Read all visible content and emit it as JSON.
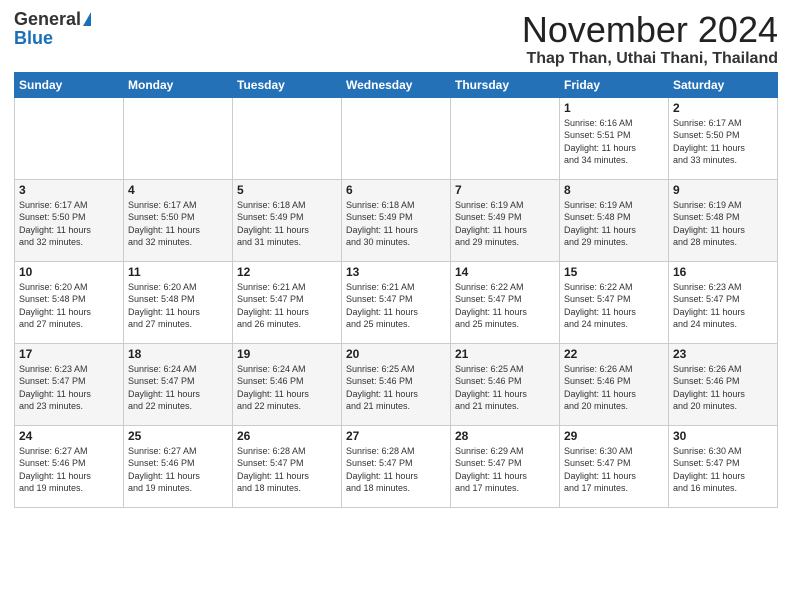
{
  "logo": {
    "general": "General",
    "blue": "Blue"
  },
  "title": {
    "month": "November 2024",
    "location": "Thap Than, Uthai Thani, Thailand"
  },
  "headers": [
    "Sunday",
    "Monday",
    "Tuesday",
    "Wednesday",
    "Thursday",
    "Friday",
    "Saturday"
  ],
  "weeks": [
    [
      {
        "day": "",
        "info": ""
      },
      {
        "day": "",
        "info": ""
      },
      {
        "day": "",
        "info": ""
      },
      {
        "day": "",
        "info": ""
      },
      {
        "day": "",
        "info": ""
      },
      {
        "day": "1",
        "info": "Sunrise: 6:16 AM\nSunset: 5:51 PM\nDaylight: 11 hours\nand 34 minutes."
      },
      {
        "day": "2",
        "info": "Sunrise: 6:17 AM\nSunset: 5:50 PM\nDaylight: 11 hours\nand 33 minutes."
      }
    ],
    [
      {
        "day": "3",
        "info": "Sunrise: 6:17 AM\nSunset: 5:50 PM\nDaylight: 11 hours\nand 32 minutes."
      },
      {
        "day": "4",
        "info": "Sunrise: 6:17 AM\nSunset: 5:50 PM\nDaylight: 11 hours\nand 32 minutes."
      },
      {
        "day": "5",
        "info": "Sunrise: 6:18 AM\nSunset: 5:49 PM\nDaylight: 11 hours\nand 31 minutes."
      },
      {
        "day": "6",
        "info": "Sunrise: 6:18 AM\nSunset: 5:49 PM\nDaylight: 11 hours\nand 30 minutes."
      },
      {
        "day": "7",
        "info": "Sunrise: 6:19 AM\nSunset: 5:49 PM\nDaylight: 11 hours\nand 29 minutes."
      },
      {
        "day": "8",
        "info": "Sunrise: 6:19 AM\nSunset: 5:48 PM\nDaylight: 11 hours\nand 29 minutes."
      },
      {
        "day": "9",
        "info": "Sunrise: 6:19 AM\nSunset: 5:48 PM\nDaylight: 11 hours\nand 28 minutes."
      }
    ],
    [
      {
        "day": "10",
        "info": "Sunrise: 6:20 AM\nSunset: 5:48 PM\nDaylight: 11 hours\nand 27 minutes."
      },
      {
        "day": "11",
        "info": "Sunrise: 6:20 AM\nSunset: 5:48 PM\nDaylight: 11 hours\nand 27 minutes."
      },
      {
        "day": "12",
        "info": "Sunrise: 6:21 AM\nSunset: 5:47 PM\nDaylight: 11 hours\nand 26 minutes."
      },
      {
        "day": "13",
        "info": "Sunrise: 6:21 AM\nSunset: 5:47 PM\nDaylight: 11 hours\nand 25 minutes."
      },
      {
        "day": "14",
        "info": "Sunrise: 6:22 AM\nSunset: 5:47 PM\nDaylight: 11 hours\nand 25 minutes."
      },
      {
        "day": "15",
        "info": "Sunrise: 6:22 AM\nSunset: 5:47 PM\nDaylight: 11 hours\nand 24 minutes."
      },
      {
        "day": "16",
        "info": "Sunrise: 6:23 AM\nSunset: 5:47 PM\nDaylight: 11 hours\nand 24 minutes."
      }
    ],
    [
      {
        "day": "17",
        "info": "Sunrise: 6:23 AM\nSunset: 5:47 PM\nDaylight: 11 hours\nand 23 minutes."
      },
      {
        "day": "18",
        "info": "Sunrise: 6:24 AM\nSunset: 5:47 PM\nDaylight: 11 hours\nand 22 minutes."
      },
      {
        "day": "19",
        "info": "Sunrise: 6:24 AM\nSunset: 5:46 PM\nDaylight: 11 hours\nand 22 minutes."
      },
      {
        "day": "20",
        "info": "Sunrise: 6:25 AM\nSunset: 5:46 PM\nDaylight: 11 hours\nand 21 minutes."
      },
      {
        "day": "21",
        "info": "Sunrise: 6:25 AM\nSunset: 5:46 PM\nDaylight: 11 hours\nand 21 minutes."
      },
      {
        "day": "22",
        "info": "Sunrise: 6:26 AM\nSunset: 5:46 PM\nDaylight: 11 hours\nand 20 minutes."
      },
      {
        "day": "23",
        "info": "Sunrise: 6:26 AM\nSunset: 5:46 PM\nDaylight: 11 hours\nand 20 minutes."
      }
    ],
    [
      {
        "day": "24",
        "info": "Sunrise: 6:27 AM\nSunset: 5:46 PM\nDaylight: 11 hours\nand 19 minutes."
      },
      {
        "day": "25",
        "info": "Sunrise: 6:27 AM\nSunset: 5:46 PM\nDaylight: 11 hours\nand 19 minutes."
      },
      {
        "day": "26",
        "info": "Sunrise: 6:28 AM\nSunset: 5:47 PM\nDaylight: 11 hours\nand 18 minutes."
      },
      {
        "day": "27",
        "info": "Sunrise: 6:28 AM\nSunset: 5:47 PM\nDaylight: 11 hours\nand 18 minutes."
      },
      {
        "day": "28",
        "info": "Sunrise: 6:29 AM\nSunset: 5:47 PM\nDaylight: 11 hours\nand 17 minutes."
      },
      {
        "day": "29",
        "info": "Sunrise: 6:30 AM\nSunset: 5:47 PM\nDaylight: 11 hours\nand 17 minutes."
      },
      {
        "day": "30",
        "info": "Sunrise: 6:30 AM\nSunset: 5:47 PM\nDaylight: 11 hours\nand 16 minutes."
      }
    ]
  ]
}
